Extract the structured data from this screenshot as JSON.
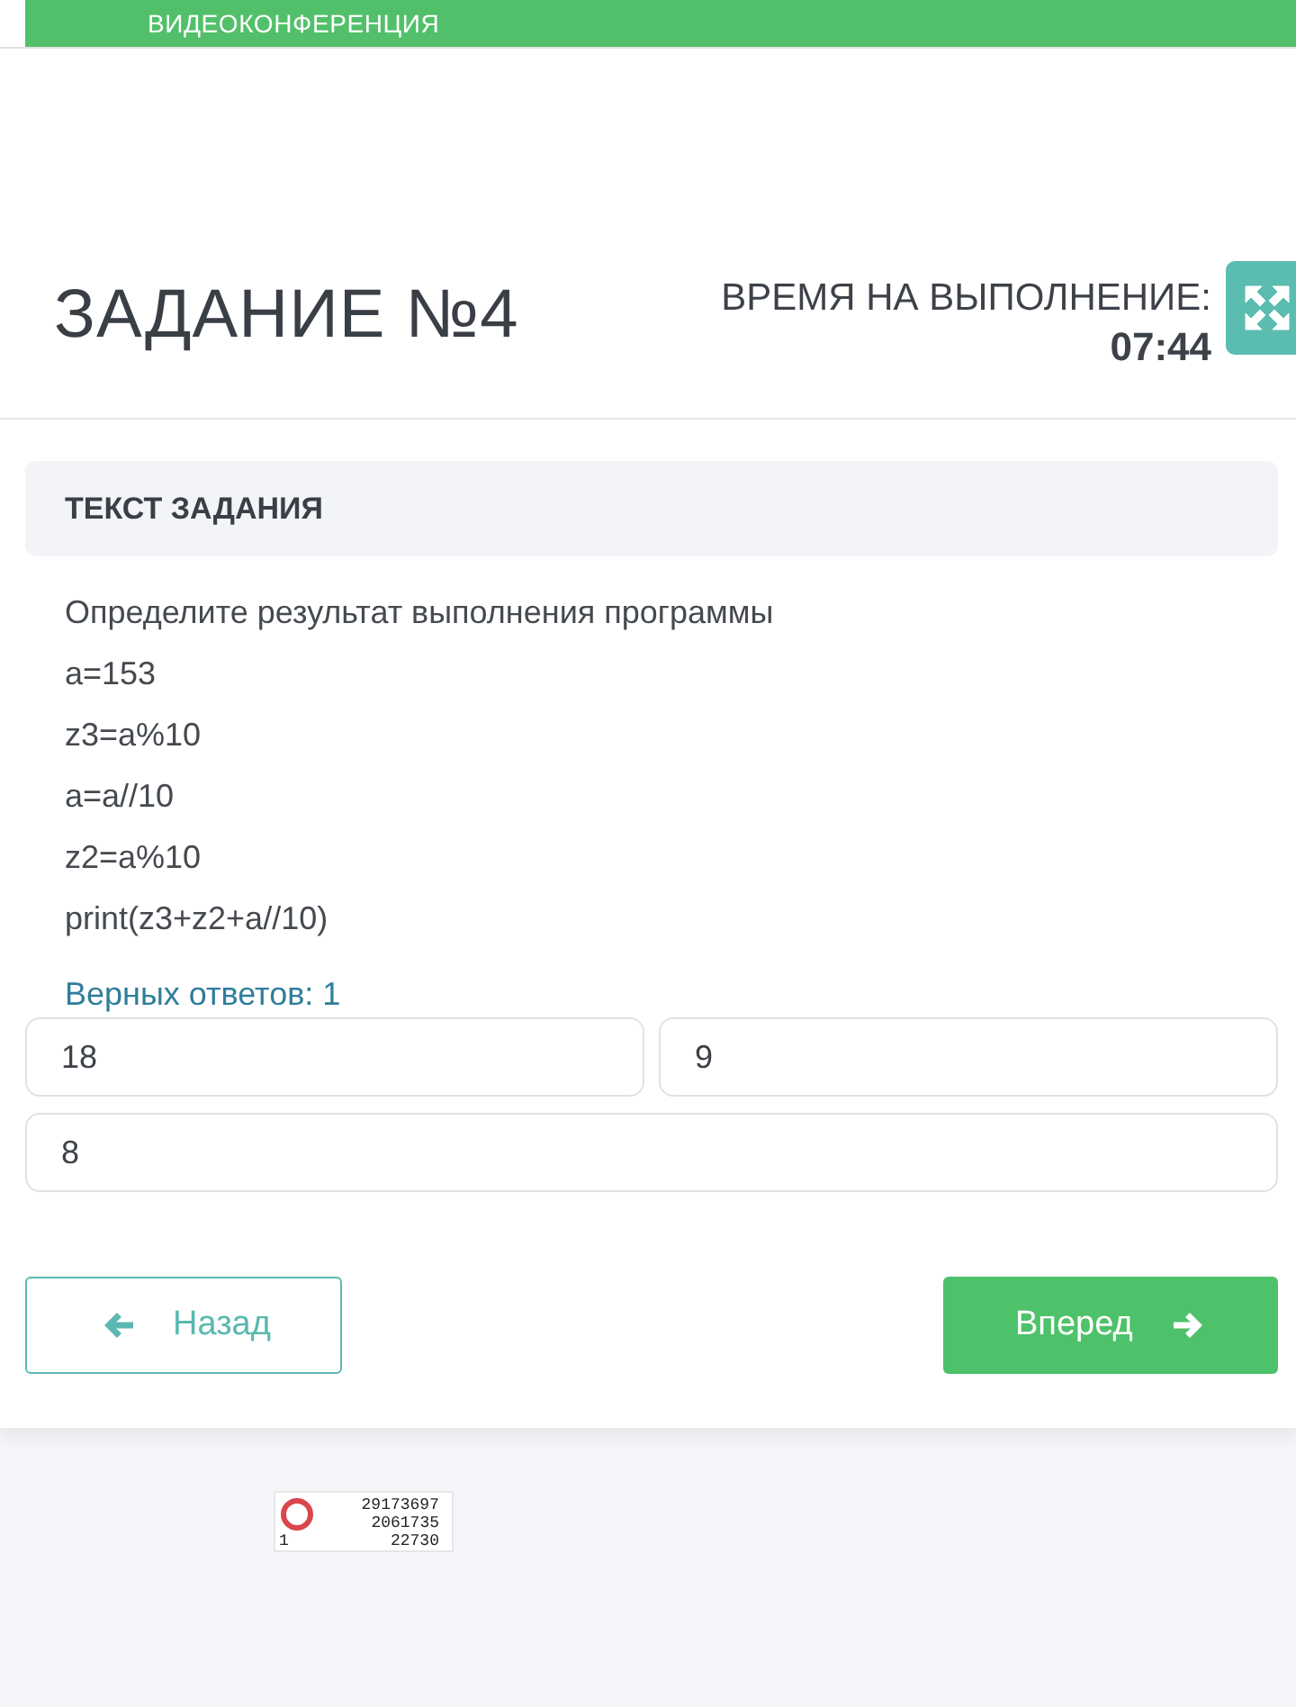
{
  "top_bar": {
    "title": "ВИДЕОКОНФЕРЕНЦИЯ"
  },
  "header": {
    "title": "ЗАДАНИЕ №4",
    "timer_label": "ВРЕМЯ НА ВЫПОЛНЕНИЕ:",
    "timer_value": "07:44"
  },
  "task": {
    "heading": "ТЕКСТ ЗАДАНИЯ",
    "lines": [
      "Определите результат выполнения программы",
      "a=153",
      "z3=a%10",
      "a=a//10",
      "z2=a%10",
      "print(z3+z2+a//10)"
    ]
  },
  "answers": {
    "hint": "Верных ответов: 1",
    "options": [
      {
        "text": "18",
        "selected": false
      },
      {
        "text": "9",
        "selected": false
      },
      {
        "text": "8",
        "selected": false
      }
    ]
  },
  "buttons": [
    {
      "kind": "back",
      "label": "Назад"
    },
    {
      "kind": "forward",
      "label": "Вперед"
    }
  ],
  "counter": {
    "numbers": [
      "29173697",
      "2061735",
      "22730"
    ],
    "corner_number": "1"
  }
}
